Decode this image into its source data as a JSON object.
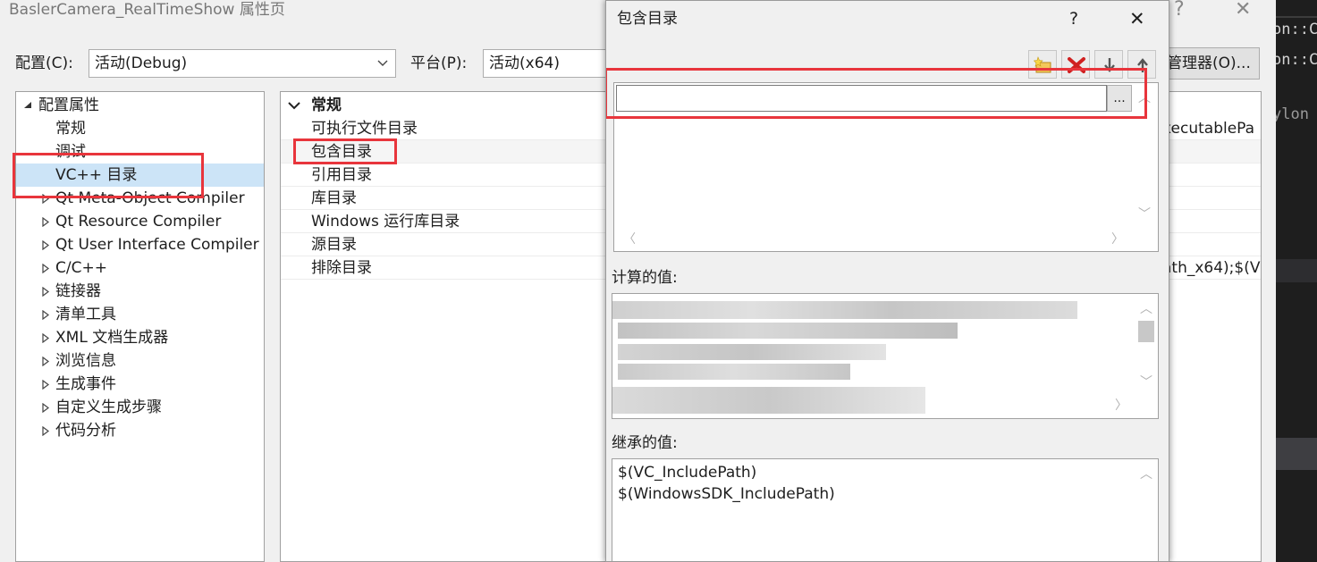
{
  "property_page": {
    "title": "BaslerCamera_RealTimeShow 属性页",
    "help_glyph": "?",
    "close_glyph": "✕",
    "config_label": "配置(C):",
    "config_value": "活动(Debug)",
    "platform_label": "平台(P):",
    "platform_value": "活动(x64)",
    "config_manager_label": "管理器(O)..."
  },
  "tree": {
    "root": "配置属性",
    "items": [
      {
        "label": "常规",
        "expandable": false
      },
      {
        "label": "调试",
        "expandable": false
      },
      {
        "label": "VC++ 目录",
        "expandable": false,
        "selected": true
      },
      {
        "label": "Qt Meta-Object Compiler",
        "expandable": true
      },
      {
        "label": "Qt Resource Compiler",
        "expandable": true
      },
      {
        "label": "Qt User Interface Compiler",
        "expandable": true
      },
      {
        "label": "C/C++",
        "expandable": true
      },
      {
        "label": "链接器",
        "expandable": true
      },
      {
        "label": "清单工具",
        "expandable": true
      },
      {
        "label": "XML 文档生成器",
        "expandable": true
      },
      {
        "label": "浏览信息",
        "expandable": true
      },
      {
        "label": "生成事件",
        "expandable": true
      },
      {
        "label": "自定义生成步骤",
        "expandable": true
      },
      {
        "label": "代码分析",
        "expandable": true
      }
    ]
  },
  "grid": {
    "section": "常规",
    "rows": [
      {
        "name": "可执行文件目录",
        "value": "xecutablePa"
      },
      {
        "name": "包含目录",
        "value": ""
      },
      {
        "name": "引用目录",
        "value": ""
      },
      {
        "name": "库目录",
        "value": ""
      },
      {
        "name": "Windows 运行库目录",
        "value": ""
      },
      {
        "name": "源目录",
        "value": ""
      },
      {
        "name": "排除目录",
        "value": "ath_x64);$(V"
      }
    ]
  },
  "editor_strip": {
    "lines": [
      "on::CG",
      "on::Cl",
      "ylon"
    ]
  },
  "dialog": {
    "title": "包含目录",
    "help_glyph": "?",
    "close_glyph": "✕",
    "toolbar": {
      "new_line_icon": "new-line-icon",
      "delete_icon": "delete-icon",
      "move_down_icon": "arrow-down-icon",
      "move_up_icon": "arrow-up-icon"
    },
    "edit_value": "",
    "browse_label": "...",
    "evaluated_label": "计算的值:",
    "inherited_label": "继承的值:",
    "inherited_values": [
      "$(VC_IncludePath)",
      "$(WindowsSDK_IncludePath)"
    ]
  },
  "colors": {
    "highlight_red": "#e8353c",
    "selection_blue": "#cce4f7"
  }
}
